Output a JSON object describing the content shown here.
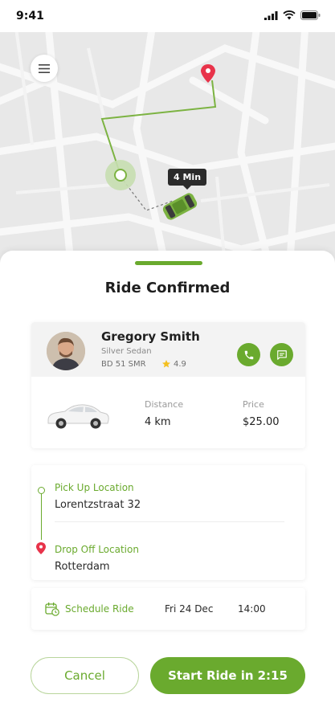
{
  "status_bar": {
    "time": "9:41"
  },
  "map": {
    "eta": "4 Min",
    "icons": {
      "menu": "hamburger-menu-icon",
      "destination": "map-pin-icon",
      "origin": "location-dot-icon",
      "vehicle": "car-top-view-icon"
    }
  },
  "sheet": {
    "title": "Ride Confirmed"
  },
  "driver": {
    "name": "Gregory Smith",
    "car": "Silver Sedan",
    "plate": "BD 51 SMR",
    "rating": "4.9",
    "icons": {
      "call": "phone-icon",
      "chat": "chat-icon",
      "rating": "star-icon"
    }
  },
  "trip": {
    "distance_label": "Distance",
    "distance_value": "4 km",
    "price_label": "Price",
    "price_value": "$25.00"
  },
  "locations": {
    "pickup_label": "Pick Up Location",
    "pickup_value": "Lorentzstraat 32",
    "dropoff_label": "Drop Off Location",
    "dropoff_value": "Rotterdam"
  },
  "schedule": {
    "label": "Schedule Ride",
    "date": "Fri 24 Dec",
    "time": "14:00"
  },
  "actions": {
    "cancel_label": "Cancel",
    "start_label": "Start Ride in",
    "countdown": "2:15"
  },
  "colors": {
    "accent": "#6aaa2e",
    "pin": "#e8334a",
    "dark": "#2b2b2b"
  }
}
